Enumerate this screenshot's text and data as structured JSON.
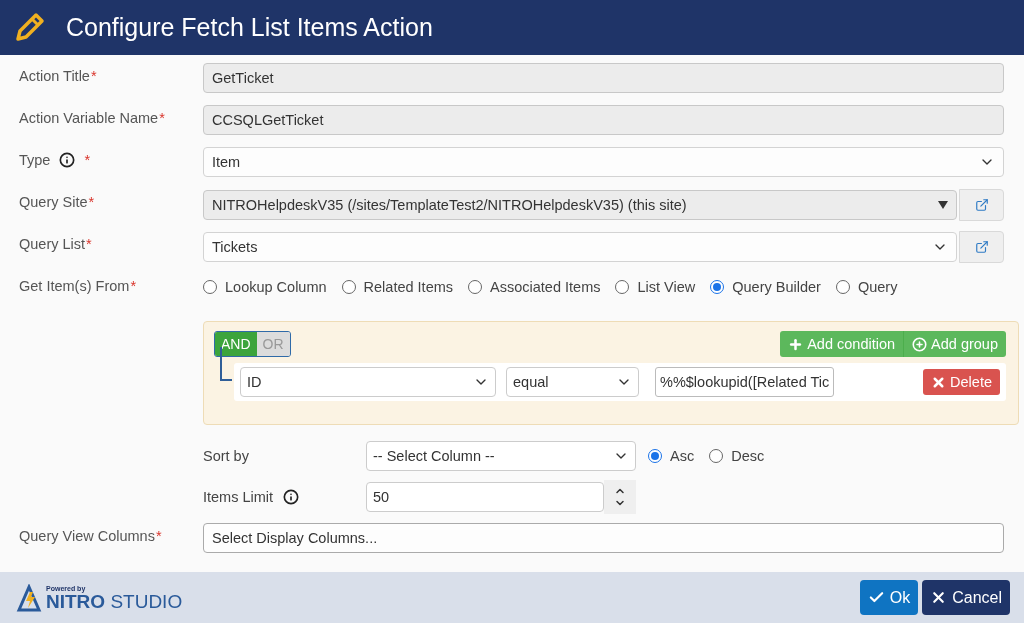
{
  "dialog": {
    "title": "Configure Fetch List Items Action"
  },
  "fields": [
    {
      "kind": "input",
      "label": "Action Title",
      "required_mark": "*",
      "readonly": true,
      "value": "GetTicket"
    },
    {
      "kind": "input",
      "label": "Action Variable Name",
      "required_mark": "*",
      "readonly": true,
      "value": "CCSQLGetTicket"
    },
    {
      "kind": "select",
      "label": "Type",
      "required_mark": "*",
      "info": true,
      "value": "Item"
    },
    {
      "kind": "site-select",
      "label": "Query Site",
      "required_mark": "*",
      "value": "NITROHelpdeskV35 (/sites/TemplateTest2/NITROHelpdeskV35) (this site)"
    },
    {
      "kind": "list-select",
      "label": "Query List",
      "required_mark": "*",
      "value": "Tickets"
    },
    {
      "kind": "radio",
      "label": "Get Item(s) From",
      "required_mark": "*",
      "options": [
        {
          "label": "Lookup Column",
          "selected": false
        },
        {
          "label": "Related Items",
          "selected": false
        },
        {
          "label": "Associated Items",
          "selected": false
        },
        {
          "label": "List View",
          "selected": false
        },
        {
          "label": "Query Builder",
          "selected": true
        },
        {
          "label": "Query",
          "selected": false
        }
      ]
    }
  ],
  "query_builder": {
    "operators": [
      {
        "label": "AND",
        "selected": true
      },
      {
        "label": "OR",
        "selected": false
      }
    ],
    "buttons": [
      {
        "kind": "plus",
        "label": "Add condition"
      },
      {
        "kind": "circle-plus",
        "label": "Add group"
      }
    ],
    "rules": [
      {
        "field": "ID",
        "operator": "equal",
        "value": "%%$lookupid([Related Tic",
        "delete": "Delete"
      }
    ]
  },
  "sort": {
    "label": "Sort by",
    "value": "-- Select Column --",
    "order": [
      {
        "label": "Asc",
        "selected": true
      },
      {
        "label": "Desc",
        "selected": false
      }
    ]
  },
  "items_limit": {
    "label": "Items Limit",
    "info": true,
    "value": "50"
  },
  "view_columns": {
    "label": "Query View Columns",
    "required_mark": "*",
    "value": "Select Display Columns..."
  },
  "footer": {
    "powered_by": "Powered by",
    "brand_bold": "NITRO",
    "brand_light": "STUDIO",
    "buttons": [
      {
        "kind": "primary",
        "label": "Ok"
      },
      {
        "kind": "secondary",
        "label": "Cancel"
      }
    ]
  }
}
